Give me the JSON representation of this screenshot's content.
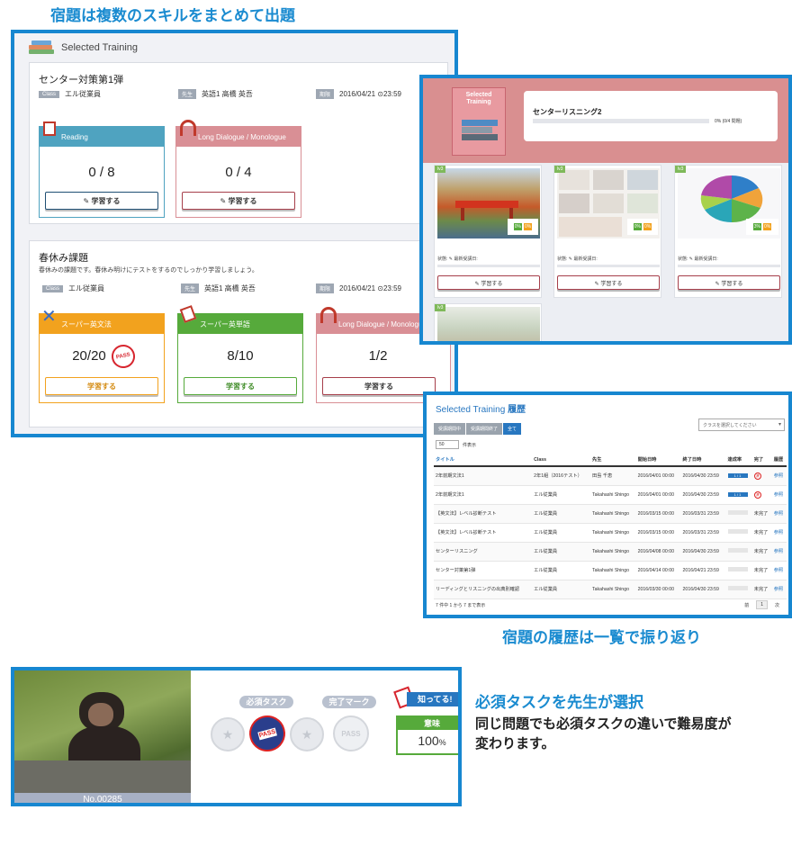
{
  "captions": {
    "top": "宿題は複数のスキルをまとめて出題",
    "history": "宿題の履歴は一覧で振り返り",
    "required_title": "必須タスクを先生が選択",
    "required_desc1": "同じ問題でも必須タスクの違いで難易度が",
    "required_desc2": "変わります。"
  },
  "panel1": {
    "header": "Selected Training",
    "assignments": [
      {
        "title": "センター対策第1弾",
        "desc": "",
        "class_tag": "Class",
        "class_value": "エル従業員",
        "teacher_tag": "先生",
        "teacher_value": "英語1 高橋 英吾",
        "due_tag": "期限",
        "due_value": "2016/04/21 ⊙23:59",
        "skills": [
          {
            "name": "Reading",
            "score": "0 / 8",
            "button": "✎ 学習する",
            "color": "#4fa3c0"
          },
          {
            "name": "Long Dialogue / Monologue",
            "score": "0 / 4",
            "button": "✎ 学習する",
            "color": "#d98f95"
          }
        ]
      },
      {
        "title": "春休み課題",
        "desc": "春休みの課題です。春休み明けにテストをするのでしっかり学習しましょう。",
        "class_tag": "Class",
        "class_value": "エル従業員",
        "teacher_tag": "先生",
        "teacher_value": "英語1 高橋 英吾",
        "due_tag": "期限",
        "due_value": "2016/04/21 ⊙23:59",
        "skills": [
          {
            "name": "スーパー英文法",
            "score": "20/20",
            "button": "学習する",
            "color": "#f2a21e",
            "pass": "PASS"
          },
          {
            "name": "スーパー英単語",
            "score": "8/10",
            "button": "学習する",
            "color": "#56aa3b"
          },
          {
            "name": "Long Dialogue / Monologue",
            "score": "1/2",
            "button": "学習する",
            "color": "#d98f95"
          }
        ]
      }
    ]
  },
  "panel2": {
    "cover_text": "Selected Training",
    "course_title": "センターリスニング2",
    "progress_text": "0% (0/4 問題)",
    "tiles": [
      {
        "level": "lv3",
        "status": "状態: ✎ 最新受講日:",
        "button": "✎ 学習する",
        "badges": [
          "0%",
          "0%"
        ]
      },
      {
        "level": "lv3",
        "status": "状態: ✎ 最新受講日:",
        "button": "✎ 学習する",
        "badges": [
          "0%",
          "0%"
        ]
      },
      {
        "level": "lv3",
        "status": "状態: ✎ 最新受講日:",
        "button": "✎ 学習する",
        "badges": [
          "3%",
          "0%"
        ]
      },
      {
        "level": "lv3",
        "status": "",
        "button": "",
        "badges": []
      }
    ]
  },
  "panel3": {
    "title_en": "Selected Training",
    "title_jp": "履歴",
    "tabs": [
      "受講期間中",
      "受講期間終了",
      "全て"
    ],
    "select_placeholder": "クラスを選択してください",
    "per_page": "50",
    "per_page_label": "件表示",
    "columns": [
      "タイトル",
      "Class",
      "先生",
      "開始日時",
      "終了日時",
      "達成率",
      "完了",
      "履歴"
    ],
    "rows": [
      [
        "2年前期文法1",
        "2年1組（2016テスト）",
        "田島 千恵",
        "2016/04/01 00:00",
        "2016/04/30 23:59",
        "1 / 1",
        "seal",
        "参照"
      ],
      [
        "2年前期文法1",
        "エル従業員",
        "Takahashi Shingo",
        "2016/04/01 00:00",
        "2016/04/30 23:59",
        "1 / 1",
        "seal",
        "参照"
      ],
      [
        "【英文法】レベル診断テスト",
        "エル従業員",
        "Takahashi Shingo",
        "2016/03/15 00:00",
        "2016/03/31 23:59",
        "",
        "未完了",
        "参照"
      ],
      [
        "【英文法】レベル診断テスト",
        "エル従業員",
        "Takahashi Shingo",
        "2016/03/15 00:00",
        "2016/03/31 23:59",
        "",
        "未完了",
        "参照"
      ],
      [
        "センターリスニング",
        "エル従業員",
        "Takahashi Shingo",
        "2016/04/08 00:00",
        "2016/04/30 23:59",
        "",
        "未完了",
        "参照"
      ],
      [
        "センター対策第1弾",
        "エル従業員",
        "Takahashi Shingo",
        "2016/04/14 00:00",
        "2016/04/21 23:59",
        "",
        "未完了",
        "参照"
      ],
      [
        "リーディングとリスニングの出典別確認",
        "エル従業員",
        "Takahashi Shingo",
        "2016/03/30 00:00",
        "2016/04/30 23:59",
        "",
        "未完了",
        "参照"
      ]
    ],
    "footer": "7 件中 1 から 7 まで表示",
    "pager": [
      "前",
      "1",
      "次"
    ]
  },
  "panel4": {
    "photo_caption": "No.00285",
    "required_label": "必須タスク",
    "done_label": "完了マーク",
    "pass_text": "PASS",
    "know_label": "知ってる!",
    "meaning_label": "意味",
    "meaning_value": "100",
    "meaning_unit": "%"
  },
  "colors": {
    "frame": "#1787d0",
    "accent": "#1a8bd0",
    "blue": "#2877c0",
    "green": "#56aa3b",
    "orange": "#f2a21e",
    "pink": "#d98f95",
    "teal": "#4fa3c0"
  }
}
